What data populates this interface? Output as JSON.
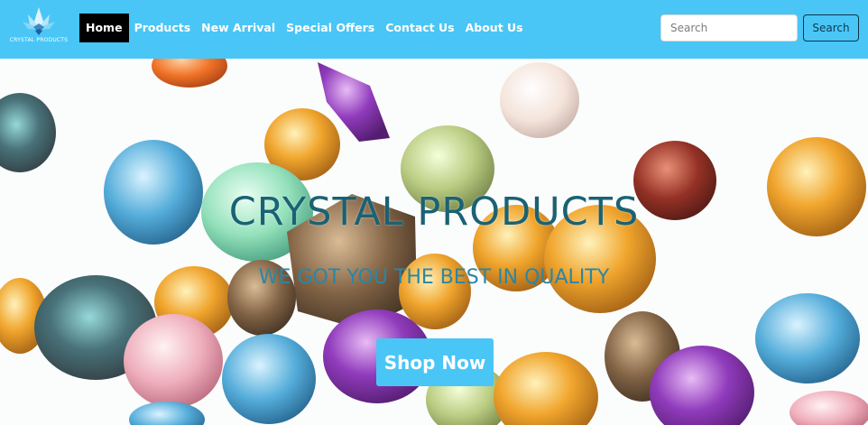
{
  "brand": {
    "logo_text": "CRYSTAL PRODUCTS",
    "logo_icon": "crystal-lotus-icon"
  },
  "nav": {
    "items": [
      {
        "label": "Home",
        "active": true
      },
      {
        "label": "Products",
        "active": false
      },
      {
        "label": "New Arrival",
        "active": false
      },
      {
        "label": "Special Offers",
        "active": false
      },
      {
        "label": "Contact Us",
        "active": false
      },
      {
        "label": "About Us",
        "active": false
      }
    ]
  },
  "search": {
    "placeholder": "Search",
    "value": "",
    "button_label": "Search"
  },
  "hero": {
    "title": "CRYSTAL PRODUCTS",
    "subtitle": "WE GOT YOU THE BEST IN QUALITY",
    "cta_label": "Shop Now",
    "background": "assorted-gemstones-photo"
  },
  "colors": {
    "navbar_bg": "#49c6f6",
    "active_nav_bg": "#000000",
    "cta_bg": "#49c6f6",
    "title_color": "#1a6274",
    "subtitle_color": "#2a86a6"
  }
}
